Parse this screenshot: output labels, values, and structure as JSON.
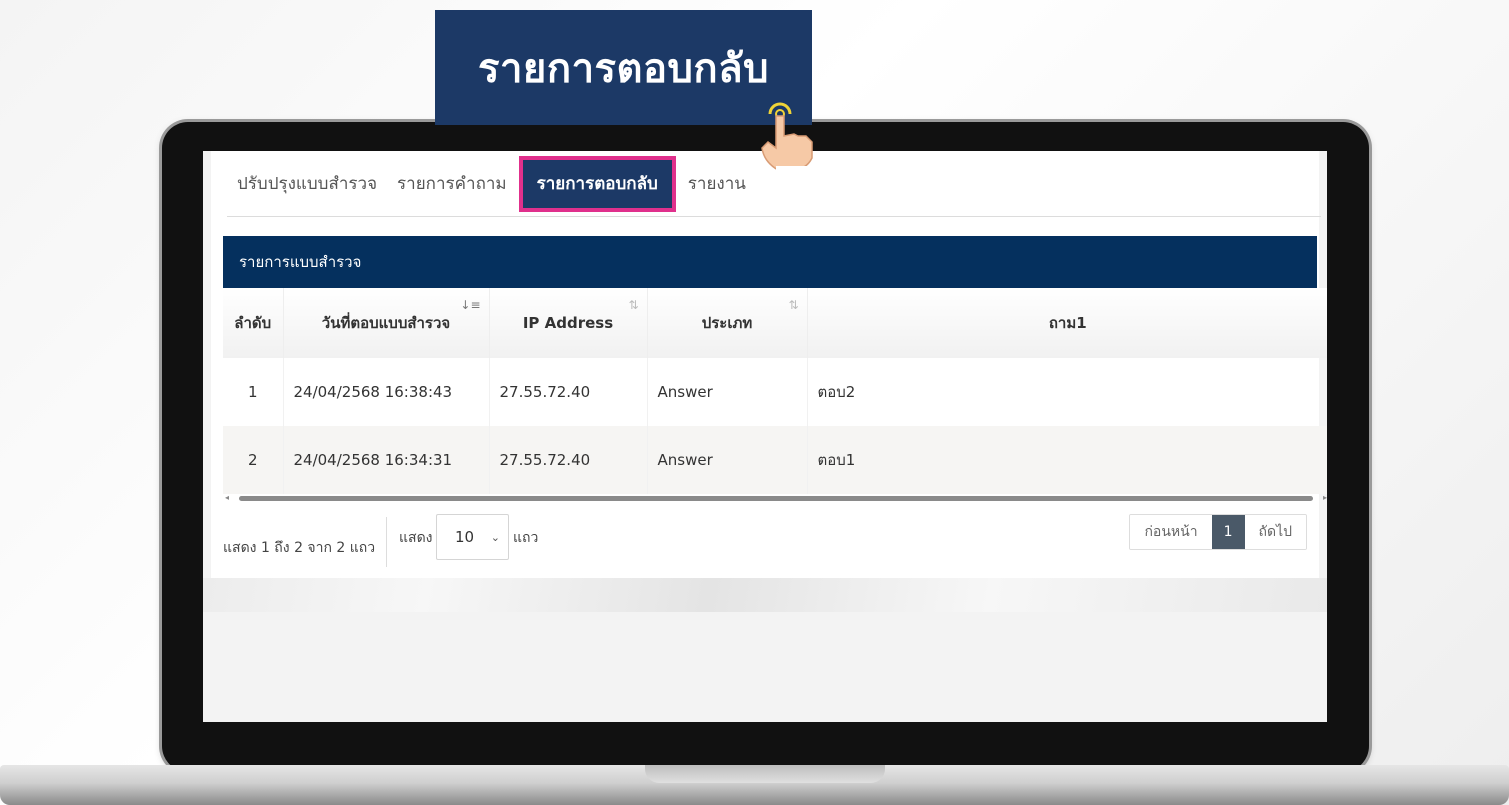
{
  "banner": {
    "title": "รายการตอบกลับ"
  },
  "tabs": [
    {
      "label": "ปรับปรุงแบบสำรวจ",
      "active": false
    },
    {
      "label": "รายการคำถาม",
      "active": false
    },
    {
      "label": "รายการตอบกลับ",
      "active": true
    },
    {
      "label": "รายงาน",
      "active": false
    }
  ],
  "card": {
    "title": "รายการแบบสำรวจ"
  },
  "table": {
    "headers": [
      "ลำดับ",
      "วันที่ตอบแบบสำรวจ",
      "IP Address",
      "ประเภท",
      "ถาม1"
    ],
    "rows": [
      [
        "1",
        "24/04/2568 16:38:43",
        "27.55.72.40",
        "Answer",
        "ตอบ2"
      ],
      [
        "2",
        "24/04/2568 16:34:31",
        "27.55.72.40",
        "Answer",
        "ตอบ1"
      ]
    ]
  },
  "footer": {
    "info": "แสดง 1 ถึง 2 จาก 2 แถว",
    "length_prefix": "แสดง",
    "length_value": "10",
    "length_suffix": "แถว"
  },
  "pagination": {
    "prev": "ก่อนหน้า",
    "current": "1",
    "next": "ถัดไป"
  },
  "colors": {
    "navy": "#1c3966",
    "header_dark": "#05305e",
    "highlight": "#e0308c",
    "pager_active": "#4a5968"
  }
}
